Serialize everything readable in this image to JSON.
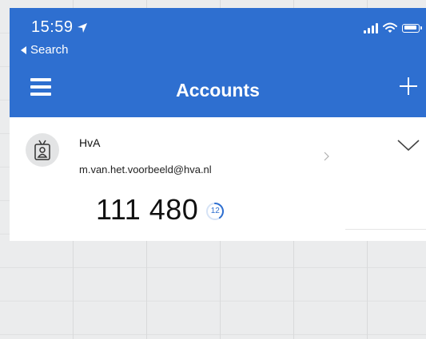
{
  "status_bar": {
    "time": "15:59",
    "back_label": "Search"
  },
  "nav": {
    "title": "Accounts"
  },
  "account": {
    "name": "HvA",
    "email": "m.van.het.voorbeeld@hva.nl",
    "code": "111 480",
    "seconds_remaining": "12",
    "seconds_total": 30
  },
  "colors": {
    "accent": "#2e6fd0",
    "background": "#ebeced"
  },
  "icons": {
    "menu": "hamburger-menu-icon",
    "add": "plus-icon",
    "avatar": "id-badge-icon",
    "expand": "chevron-down-icon",
    "detail": "chevron-right-icon"
  }
}
